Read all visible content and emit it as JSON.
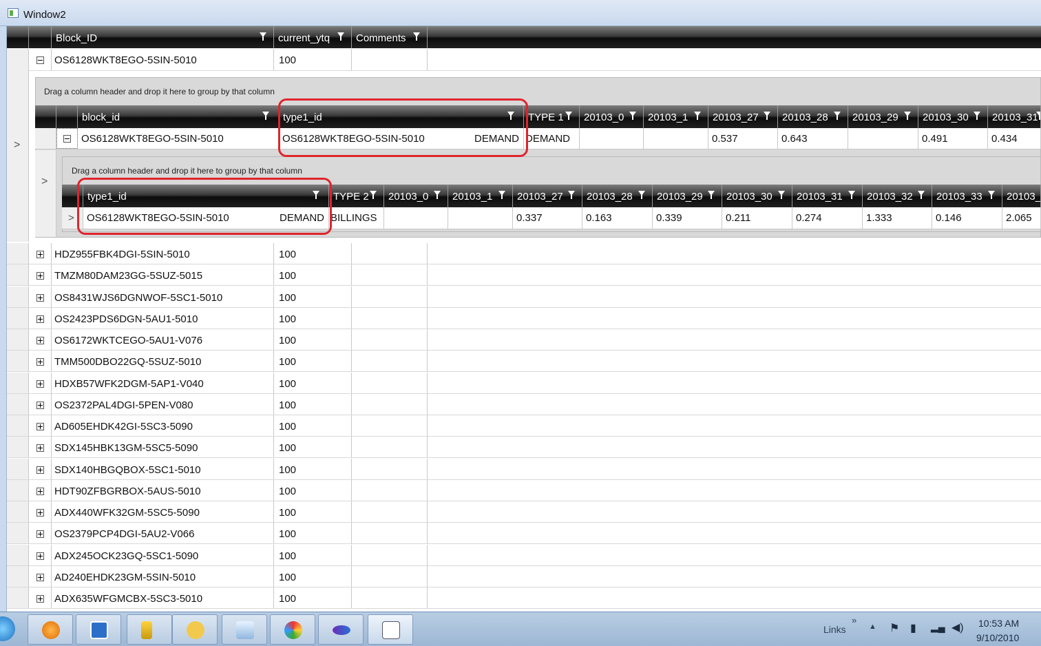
{
  "window": {
    "title": "Window2"
  },
  "main_grid": {
    "columns": [
      "Block_ID",
      "current_ytq",
      "Comments"
    ],
    "expanded_row": {
      "block_id": "OS6128WKT8EGO-5SIN-5010",
      "current_ytq": "100"
    },
    "rows": [
      {
        "block_id": "HDZ955FBK4DGI-5SIN-5010",
        "current_ytq": "100"
      },
      {
        "block_id": "TMZM80DAM23GG-5SUZ-5015",
        "current_ytq": "100"
      },
      {
        "block_id": "OS8431WJS6DGNWOF-5SC1-5010",
        "current_ytq": "100"
      },
      {
        "block_id": "OS2423PDS6DGN-5AU1-5010",
        "current_ytq": "100"
      },
      {
        "block_id": "OS6172WKTCEGO-5AU1-V076",
        "current_ytq": "100"
      },
      {
        "block_id": "TMM500DBO22GQ-5SUZ-5010",
        "current_ytq": "100"
      },
      {
        "block_id": "HDXB57WFK2DGM-5AP1-V040",
        "current_ytq": "100"
      },
      {
        "block_id": "OS2372PAL4DGI-5PEN-V080",
        "current_ytq": "100"
      },
      {
        "block_id": "AD605EHDK42GI-5SC3-5090",
        "current_ytq": "100"
      },
      {
        "block_id": "SDX145HBK13GM-5SC5-5090",
        "current_ytq": "100"
      },
      {
        "block_id": "SDX140HBGQBOX-5SC1-5010",
        "current_ytq": "100"
      },
      {
        "block_id": "HDT90ZFBGRBOX-5AUS-5010",
        "current_ytq": "100"
      },
      {
        "block_id": "ADX440WFK32GM-5SC5-5090",
        "current_ytq": "100"
      },
      {
        "block_id": "OS2379PCP4DGI-5AU2-V066",
        "current_ytq": "100"
      },
      {
        "block_id": "ADX245OCK23GQ-5SC1-5090",
        "current_ytq": "100"
      },
      {
        "block_id": "AD240EHDK23GM-5SIN-5010",
        "current_ytq": "100"
      },
      {
        "block_id": "ADX635WFGMCBX-5SC3-5010",
        "current_ytq": "100"
      }
    ]
  },
  "detail1": {
    "group_hint": "Drag a column header and drop it here to group by that column",
    "columns": [
      "block_id",
      "type1_id",
      "TYPE 1",
      "20103_0",
      "20103_1",
      "20103_27",
      "20103_28",
      "20103_29",
      "20103_30",
      "20103_31"
    ],
    "row": {
      "block_id": "OS6128WKT8EGO-5SIN-5010",
      "type1_id": "OS6128WKT8EGO-5SIN-5010",
      "type1_id_suffix": "DEMAND",
      "type1": "DEMAND",
      "v_0": "",
      "v_1": "",
      "v_27": "0.537",
      "v_28": "0.643",
      "v_29": "",
      "v_30": "0.491",
      "v_31": "0.434"
    }
  },
  "detail2": {
    "group_hint": "Drag a column header and drop it here to group by that column",
    "columns": [
      "type1_id",
      "TYPE 2",
      "20103_0",
      "20103_1",
      "20103_27",
      "20103_28",
      "20103_29",
      "20103_30",
      "20103_31",
      "20103_32",
      "20103_33",
      "20103_"
    ],
    "row": {
      "type1_id": "OS6128WKT8EGO-5SIN-5010",
      "type1_id_suffix": "DEMAND",
      "type2": "BILLINGS",
      "v_0": "",
      "v_1": "",
      "v_27": "0.337",
      "v_28": "0.163",
      "v_29": "0.339",
      "v_30": "0.211",
      "v_31": "0.274",
      "v_32": "1.333",
      "v_33": "0.146",
      "v_34": "2.065"
    }
  },
  "taskbar": {
    "links_label": "Links",
    "time": "10:53 AM",
    "date": "9/10/2010",
    "icons": [
      "ie-icon",
      "media-player-icon",
      "remote-desktop-icon",
      "sql-tools-icon",
      "outlook-icon",
      "notepad-icon",
      "paint-icon",
      "visual-studio-icon",
      "app-window-icon"
    ]
  },
  "colors": {
    "highlight": "#e0242c",
    "header_dark": "#0c0c0c",
    "taskbar": "#b8cde3"
  }
}
